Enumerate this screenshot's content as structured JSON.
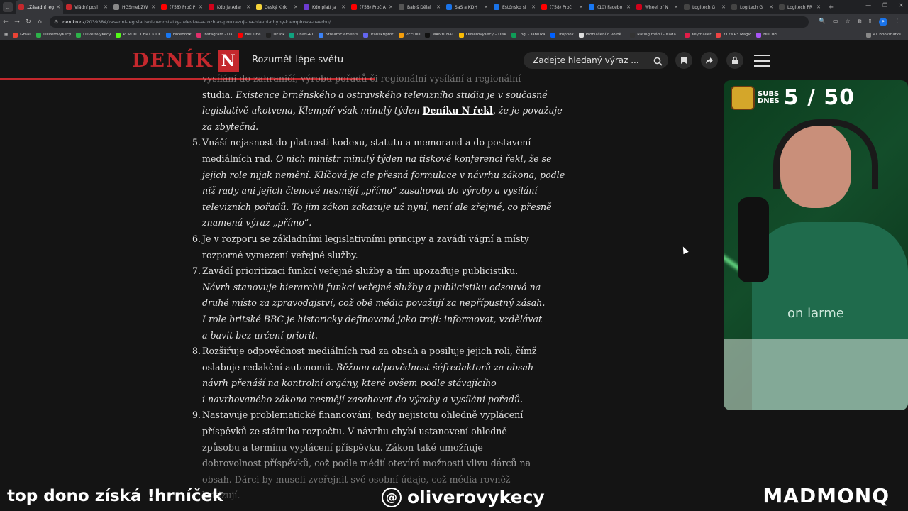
{
  "browser": {
    "tabs": [
      {
        "label": "„Zásadní leg",
        "color": "#c4282d",
        "active": true
      },
      {
        "label": "Vládní posl",
        "color": "#c4282d"
      },
      {
        "label": "HGSmebZW",
        "color": "#888888"
      },
      {
        "label": "(758) Proč P",
        "color": "#ff0000"
      },
      {
        "label": "Kdo je Adar",
        "color": "#d0021b"
      },
      {
        "label": "Český Kirk",
        "color": "#f5d33a"
      },
      {
        "label": "Kdo platí Ja",
        "color": "#6c3bd1"
      },
      {
        "label": "(758) Proč A",
        "color": "#ff0000"
      },
      {
        "label": "Babiš Dělal",
        "color": "#555555"
      },
      {
        "label": "SaS a KDH",
        "color": "#1a73e8"
      },
      {
        "label": "Estónsko si",
        "color": "#1a73e8"
      },
      {
        "label": "(758) Proč",
        "color": "#ff0000"
      },
      {
        "label": "(10) Facebo",
        "color": "#1877f2"
      },
      {
        "label": "Wheel of N",
        "color": "#d0021b"
      },
      {
        "label": "Logitech G",
        "color": "#444444"
      },
      {
        "label": "Logitech G",
        "color": "#444444"
      },
      {
        "label": "Logitech PR",
        "color": "#444444"
      }
    ],
    "address_host": "denikn.cz",
    "address_path": "/2039384/zasadni-legislativni-nedostatky-televize-a-rozhlas-poukazuji-na-hlavni-chyby-klempirova-navrhu/",
    "bookmarks": [
      {
        "label": "Gmail",
        "color": "#ea4335"
      },
      {
        "label": "OliverovyKecy",
        "color": "#2db34a"
      },
      {
        "label": "OliverovyKecy",
        "color": "#2db34a"
      },
      {
        "label": "POPOUT CHAT KICK",
        "color": "#53fc18"
      },
      {
        "label": "Facebook",
        "color": "#1877f2"
      },
      {
        "label": "Instagram - OK",
        "color": "#e1306c"
      },
      {
        "label": "YouTube",
        "color": "#ff0000"
      },
      {
        "label": "TikTok",
        "color": "#222222"
      },
      {
        "label": "ChatGPT",
        "color": "#10a37f"
      },
      {
        "label": "StreamElements",
        "color": "#3b82f6"
      },
      {
        "label": "Transkriptor",
        "color": "#6366f1"
      },
      {
        "label": "VEEDIO",
        "color": "#f59e0b"
      },
      {
        "label": "MANYCHAT",
        "color": "#111111"
      },
      {
        "label": "OliverovyKecy – Disk",
        "color": "#fbbc04"
      },
      {
        "label": "Logi - Tabulka",
        "color": "#0f9d58"
      },
      {
        "label": "Dropbox",
        "color": "#0061ff"
      },
      {
        "label": "Prohlášení o volbě...",
        "color": "#dddddd"
      },
      {
        "label": "Rating médií - Nada...",
        "color": "#333333"
      },
      {
        "label": "Keymailer",
        "color": "#e11d48"
      },
      {
        "label": "YT2MP3 Magic",
        "color": "#ef4444"
      },
      {
        "label": "HOOKS",
        "color": "#a855f7"
      }
    ],
    "all_bookmarks": "All Bookmarks"
  },
  "site": {
    "logo_word": "DENÍK",
    "logo_letter": "N",
    "tagline": "Rozumět lépe světu",
    "search_placeholder": "Zadejte hledaný výraz ...",
    "accent": "#c4282d"
  },
  "article": {
    "lines": [
      {
        "text": "vysílání do zahraničí, výrobu pořadů či regionální vysílání a regionální",
        "clip": true
      },
      {
        "segments": [
          {
            "text": "studia. "
          },
          {
            "text": "Existence brněnského a ostravského televizního studia je v současné",
            "style": "italic"
          }
        ]
      },
      {
        "segments": [
          {
            "text": "legislativě ukotvena, Klempíř však minulý týden ",
            "style": "italic"
          },
          {
            "text": "Deníku N řekl",
            "style": "link"
          },
          {
            "text": ", že je považuje",
            "style": "italic"
          }
        ]
      },
      {
        "segments": [
          {
            "text": "za zbytečná.",
            "style": "italic"
          }
        ]
      },
      {
        "num": "5.",
        "segments": [
          {
            "text": "Vnáší nejasnost do platnosti kodexu, statutu a memorand a do postavení"
          }
        ]
      },
      {
        "segments": [
          {
            "text": "mediálních rad. "
          },
          {
            "text": "O nich ministr minulý týden na tiskové konferenci řekl, že se",
            "style": "italic"
          }
        ]
      },
      {
        "segments": [
          {
            "text": "jejich role nijak nemění. Klíčová je ale přesná formulace v návrhu zákona, podle",
            "style": "italic"
          }
        ]
      },
      {
        "segments": [
          {
            "text": "níž rady ani jejich členové nesmějí „přímo“ zasahovat do výroby a vysílání",
            "style": "italic"
          }
        ]
      },
      {
        "segments": [
          {
            "text": "televizních pořadů. To jim zákon zakazuje už nyní, není ale zřejmé, co přesně",
            "style": "italic"
          }
        ]
      },
      {
        "segments": [
          {
            "text": "znamená výraz „přímo“.",
            "style": "italic"
          }
        ]
      },
      {
        "num": "6.",
        "segments": [
          {
            "text": "Je v rozporu se základními legislativními principy a zavádí vágní a místy"
          }
        ]
      },
      {
        "segments": [
          {
            "text": "rozporné vymezení veřejné služby."
          }
        ]
      },
      {
        "num": "7.",
        "segments": [
          {
            "text": "Zavádí prioritizaci funkcí veřejné služby a tím upozaďuje publicistiku."
          }
        ]
      },
      {
        "segments": [
          {
            "text": "Návrh stanovuje hierarchii funkcí veřejné služby a publicistiku odsouvá na",
            "style": "italic"
          }
        ]
      },
      {
        "segments": [
          {
            "text": "druhé místo za zpravodajství, což obě média považují za nepřípustný zásah.",
            "style": "italic"
          }
        ]
      },
      {
        "segments": [
          {
            "text": "I role britské BBC je historicky definovaná jako trojí: informovat, vzdělávat",
            "style": "italic"
          }
        ]
      },
      {
        "segments": [
          {
            "text": "a bavit bez určení priorit.",
            "style": "italic"
          }
        ]
      },
      {
        "num": "8.",
        "segments": [
          {
            "text": "Rozšiřuje odpovědnost mediálních rad za obsah a posiluje jejich roli, čímž"
          }
        ]
      },
      {
        "segments": [
          {
            "text": "oslabuje redakční autonomii. "
          },
          {
            "text": "Běžnou odpovědnost šéfredaktorů za obsah",
            "style": "italic"
          }
        ]
      },
      {
        "segments": [
          {
            "text": "návrh přenáší na kontrolní orgány, které ovšem podle stávajícího",
            "style": "italic"
          }
        ]
      },
      {
        "segments": [
          {
            "text": "i navrhovaného zákona nesmějí zasahovat do výroby a vysílání pořadů.",
            "style": "italic"
          }
        ]
      },
      {
        "num": "9.",
        "segments": [
          {
            "text": "Nastavuje problematické financování, tedy nejistotu ohledně vyplácení"
          }
        ]
      },
      {
        "segments": [
          {
            "text": "příspěvků ze státního rozpočtu. V návrhu chybí ustanovení ohledně"
          }
        ]
      },
      {
        "segments": [
          {
            "text": "způsobu a termínu vyplácení příspěvku. Zákon také umožňuje"
          }
        ]
      },
      {
        "segments": [
          {
            "text": "dobrovolnost příspěvků, což podle médií otevírá možnosti vlivu dárců na"
          }
        ]
      },
      {
        "segments": [
          {
            "text": "obsah. Dárci by museli zveřejnit své osobní údaje, což média rovněž"
          }
        ]
      },
      {
        "segments": [
          {
            "text": "kritizují."
          }
        ]
      }
    ]
  },
  "stream": {
    "subs_label_1": "SUBS",
    "subs_label_2": "DNES",
    "subs_count": "5 / 50",
    "left_text": "top dono získá !hrníček",
    "handle": "oliverovykecy",
    "right_text": "MADMONQ",
    "shirt_text": "on larme"
  }
}
